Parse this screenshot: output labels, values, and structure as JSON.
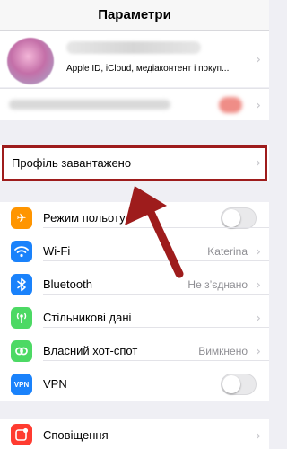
{
  "header": {
    "title": "Параметри"
  },
  "profile": {
    "subtitle": "Apple ID, iCloud, медіаконтент і покуп..."
  },
  "profile_loaded": {
    "label": "Профіль завантажено"
  },
  "settings": [
    {
      "label": "Режим польоту",
      "value": "",
      "icon": "airplane-icon",
      "color": "#ff9500",
      "glyph": "✈",
      "control": "toggle",
      "state": false
    },
    {
      "label": "Wi-Fi",
      "value": "Katerina",
      "icon": "wifi-icon",
      "color": "#1a82fb",
      "glyph": "◠",
      "control": "chevron"
    },
    {
      "label": "Bluetooth",
      "value": "Не з’єднано",
      "icon": "bluetooth-icon",
      "color": "#1a82fb",
      "glyph": "ᛒ",
      "control": "chevron"
    },
    {
      "label": "Стільникові дані",
      "value": "",
      "icon": "cellular-icon",
      "color": "#4cd964",
      "glyph": "⦿",
      "control": "chevron"
    },
    {
      "label": "Власний хот-спот",
      "value": "Вимкнено",
      "icon": "hotspot-icon",
      "color": "#4cd964",
      "glyph": "∞",
      "control": "chevron"
    },
    {
      "label": "VPN",
      "value": "",
      "icon": "vpn-icon",
      "color": "#1a82fb",
      "glyph": "VPN",
      "control": "toggle",
      "state": false
    }
  ],
  "notifications": {
    "label": "Сповіщення",
    "icon_color": "#ff3b30"
  },
  "colors": {
    "annotation": "#9e1c1c",
    "background": "#efeff4"
  }
}
